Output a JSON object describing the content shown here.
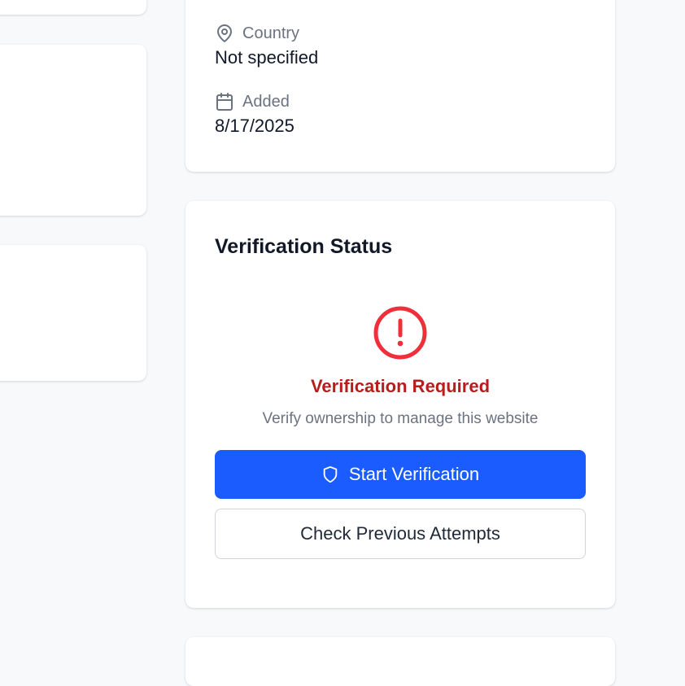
{
  "info": {
    "country_label": "Country",
    "country_value": "Not specified",
    "added_label": "Added",
    "added_value": "8/17/2025",
    "country_icon": "map-pin-icon",
    "added_icon": "calendar-icon"
  },
  "verification": {
    "title": "Verification Status",
    "status_icon": "alert-circle-icon",
    "status_title": "Verification Required",
    "status_subtitle": "Verify ownership to manage this website",
    "start_button_label": "Start Verification",
    "start_button_icon": "shield-icon",
    "check_button_label": "Check Previous Attempts"
  },
  "colors": {
    "primary": "#1a5cff",
    "danger": "#ef2f3a",
    "danger_text": "#b91c1c",
    "muted_text": "#6b7280",
    "page_background": "#f8f9fb"
  }
}
